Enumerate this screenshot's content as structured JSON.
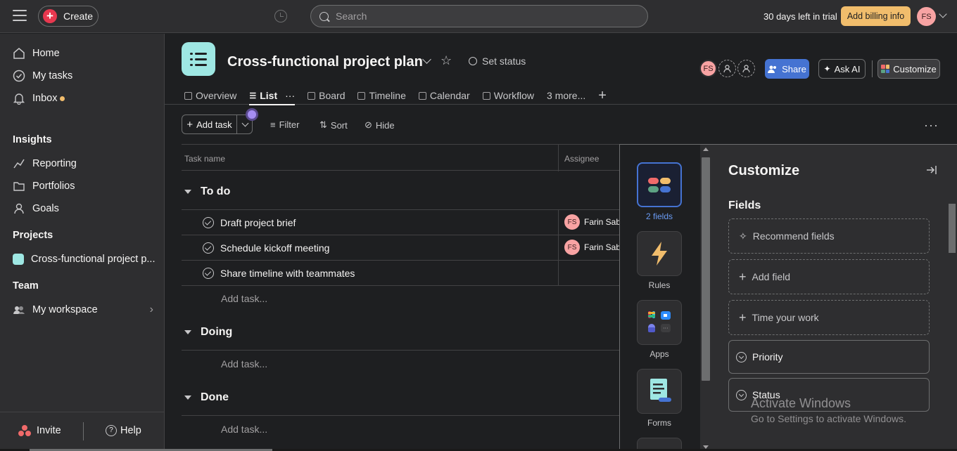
{
  "topbar": {
    "create_label": "Create",
    "search_placeholder": "Search",
    "trial_text": "30 days left in trial",
    "billing_label": "Add billing info",
    "user_initials": "FS"
  },
  "sidebar": {
    "nav": [
      {
        "label": "Home",
        "icon": "home-icon"
      },
      {
        "label": "My tasks",
        "icon": "check-circle-icon"
      },
      {
        "label": "Inbox",
        "icon": "bell-icon"
      }
    ],
    "insights_title": "Insights",
    "insights": [
      {
        "label": "Reporting",
        "icon": "trend-line-icon"
      },
      {
        "label": "Portfolios",
        "icon": "folder-icon"
      },
      {
        "label": "Goals",
        "icon": "person-icon"
      }
    ],
    "projects_title": "Projects",
    "project_item": "Cross-functional project p...",
    "team_title": "Team",
    "team_item": "My workspace",
    "invite_label": "Invite",
    "help_label": "Help"
  },
  "project": {
    "title": "Cross-functional project plan",
    "set_status": "Set status",
    "member_initials": "FS",
    "share_label": "Share",
    "ask_ai_label": "Ask AI",
    "customize_label": "Customize",
    "tabs": [
      {
        "label": "Overview"
      },
      {
        "label": "List"
      },
      {
        "label": "Board"
      },
      {
        "label": "Timeline"
      },
      {
        "label": "Calendar"
      },
      {
        "label": "Workflow"
      },
      {
        "label": "3 more..."
      }
    ]
  },
  "toolbar": {
    "add_task_label": "Add task",
    "filter_label": "Filter",
    "sort_label": "Sort",
    "hide_label": "Hide"
  },
  "table": {
    "col_task": "Task name",
    "col_assignee": "Assignee",
    "groups": [
      {
        "name": "To do",
        "tasks": [
          {
            "name": "Draft project brief",
            "assignee": "Farin Sab",
            "initials": "FS"
          },
          {
            "name": "Schedule kickoff meeting",
            "assignee": "Farin Sab",
            "initials": "FS"
          },
          {
            "name": "Share timeline with teammates",
            "assignee": "",
            "initials": ""
          }
        ],
        "add_task": "Add task..."
      },
      {
        "name": "Doing",
        "tasks": [],
        "add_task": "Add task..."
      },
      {
        "name": "Done",
        "tasks": [],
        "add_task": "Add task..."
      }
    ]
  },
  "customize_panel": {
    "title": "Customize",
    "rail": [
      {
        "label": "2 fields",
        "icon": "fields-icon"
      },
      {
        "label": "Rules",
        "icon": "lightning-icon"
      },
      {
        "label": "Apps",
        "icon": "apps-icon"
      },
      {
        "label": "Forms",
        "icon": "form-icon"
      }
    ],
    "fields_title": "Fields",
    "recommend_label": "Recommend fields",
    "add_field_label": "Add field",
    "time_label": "Time your work",
    "priority_label": "Priority",
    "status_label": "Status"
  },
  "watermark": {
    "line1": "Activate Windows",
    "line2": "Go to Settings to activate Windows."
  }
}
